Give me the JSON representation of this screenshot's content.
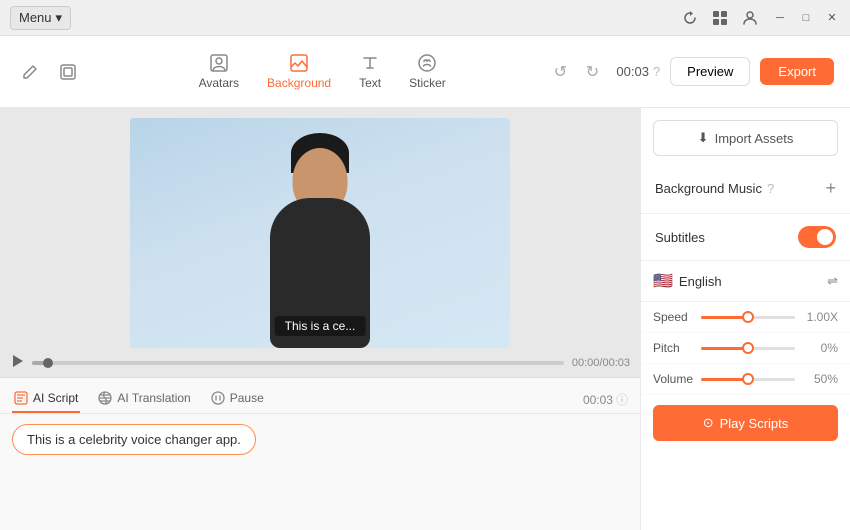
{
  "titlebar": {
    "menu_label": "Menu",
    "chevron": "▾"
  },
  "toolbar": {
    "avatars_label": "Avatars",
    "background_label": "Background",
    "text_label": "Text",
    "sticker_label": "Sticker",
    "time": "00:03",
    "preview_label": "Preview",
    "export_label": "Export"
  },
  "video": {
    "subtitle_text": "This is a ce...",
    "time_display": "00:00/00:03"
  },
  "editor": {
    "tab_ai_script": "AI Script",
    "tab_ai_translation": "AI Translation",
    "tab_pause": "Pause",
    "duration": "00:03",
    "script_text": "This is a celebrity voice changer app."
  },
  "right_panel": {
    "import_label": "Import Assets",
    "bg_music_label": "Background Music",
    "subtitles_label": "Subtitles"
  },
  "voice_panel": {
    "language": "English",
    "speed_label": "Speed",
    "speed_val": "1.00X",
    "speed_pct": 50,
    "pitch_label": "Pitch",
    "pitch_val": "0%",
    "pitch_pct": 50,
    "volume_label": "Volume",
    "volume_val": "50%",
    "volume_pct": 50,
    "play_scripts_label": "Play Scripts"
  }
}
